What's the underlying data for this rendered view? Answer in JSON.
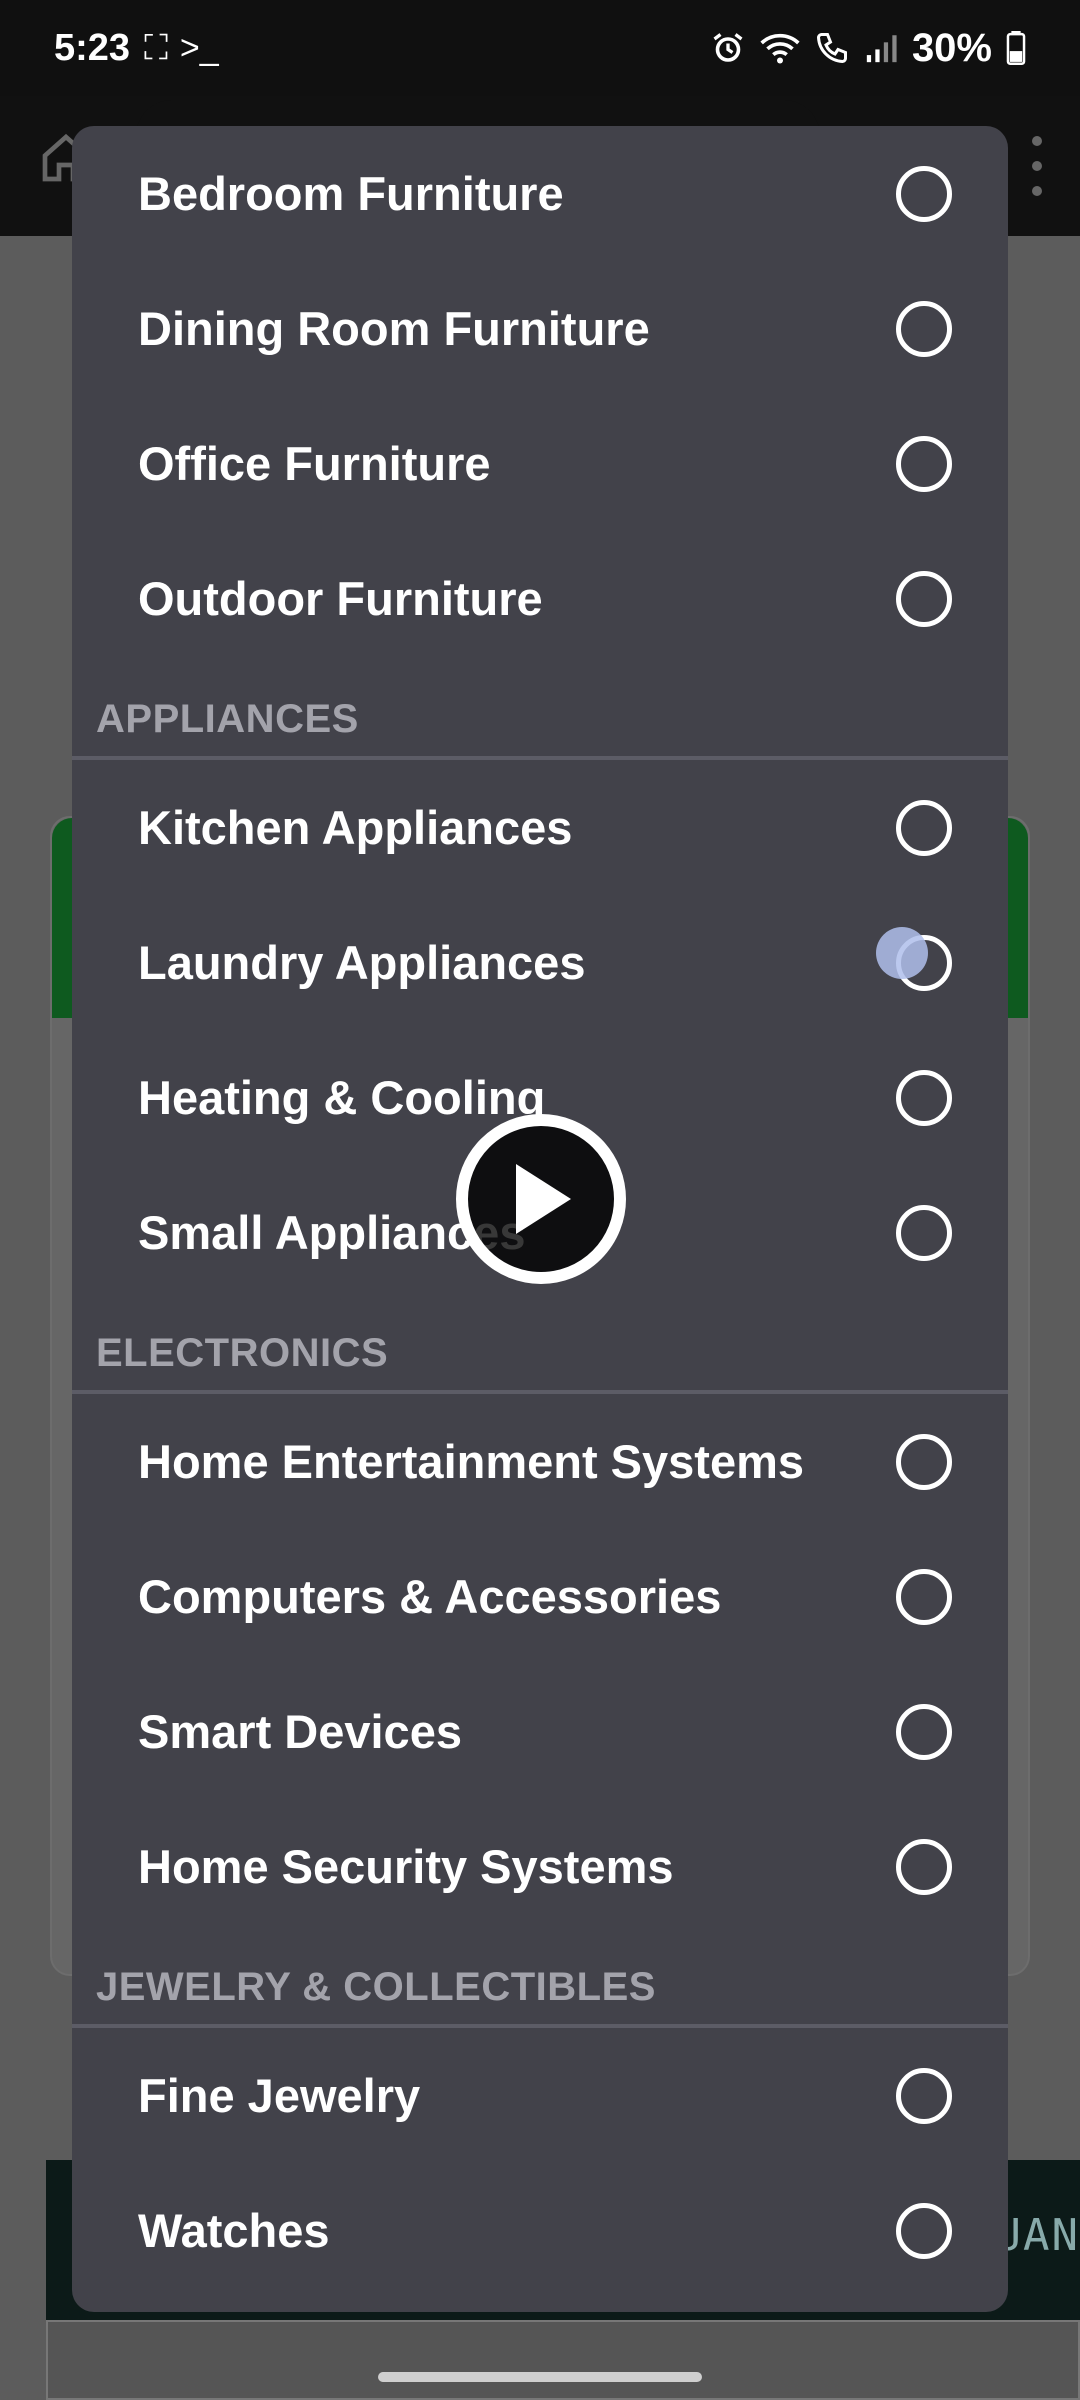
{
  "status_bar": {
    "time": "5:23",
    "battery": "30%"
  },
  "background": {
    "strip_text": "UAN"
  },
  "dialog": {
    "rows_top": [
      {
        "label": "Bedroom Furniture"
      },
      {
        "label": "Dining Room Furniture"
      },
      {
        "label": "Office Furniture"
      },
      {
        "label": "Outdoor Furniture"
      }
    ],
    "sections": [
      {
        "header": "APPLIANCES",
        "items": [
          {
            "label": "Kitchen Appliances"
          },
          {
            "label": "Laundry Appliances"
          },
          {
            "label": "Heating & Cooling"
          },
          {
            "label": "Small Appliances"
          }
        ]
      },
      {
        "header": "ELECTRONICS",
        "items": [
          {
            "label": "Home Entertainment Systems"
          },
          {
            "label": "Computers & Accessories"
          },
          {
            "label": "Smart Devices"
          },
          {
            "label": "Home Security Systems"
          }
        ]
      },
      {
        "header": "JEWELRY & COLLECTIBLES",
        "items": [
          {
            "label": "Fine Jewelry"
          },
          {
            "label": "Watches"
          }
        ]
      }
    ]
  },
  "colors": {
    "dialog_bg": "#42424a",
    "section_header": "#a3a3ab",
    "divider": "#5c5c66",
    "app_green": "#0e5a1f"
  }
}
